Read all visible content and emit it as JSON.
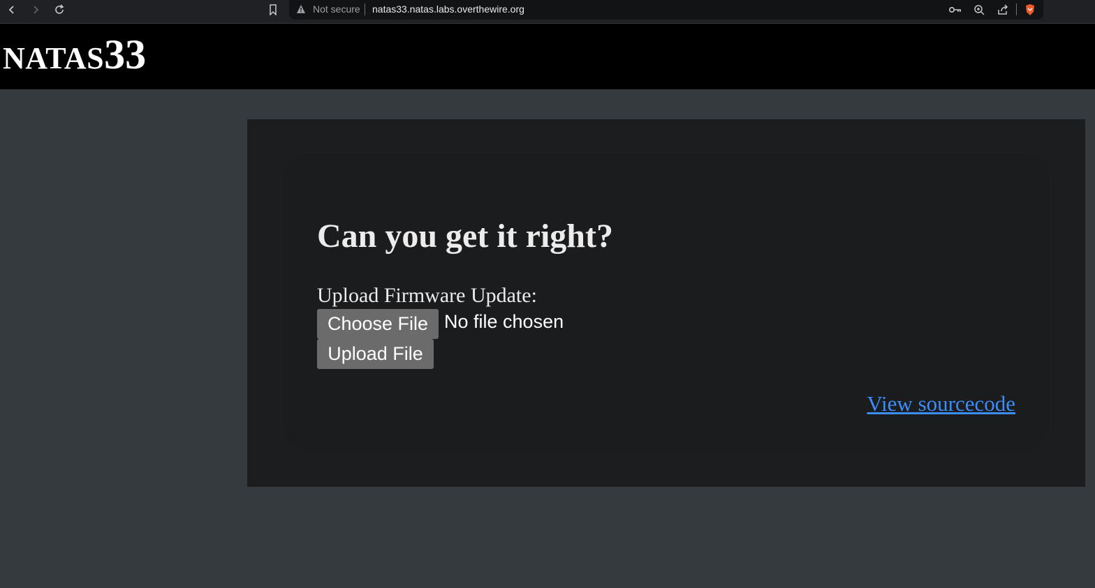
{
  "browser": {
    "security_label": "Not secure",
    "url": "natas33.natas.labs.overthewire.org",
    "icons": [
      "back-icon",
      "forward-icon",
      "reload-icon",
      "bookmark-icon",
      "warning-icon",
      "key-icon",
      "zoom-icon",
      "share-icon",
      "brave-shield-icon"
    ]
  },
  "header": {
    "title_prefix": "NATAS",
    "title_number": "33"
  },
  "content": {
    "heading": "Can you get it right?",
    "upload_label": "Upload Firmware Update:",
    "choose_file_label": "Choose File",
    "file_status": "No file chosen",
    "upload_button_label": "Upload File",
    "source_link": "View sourcecode"
  },
  "colors": {
    "page_bg": "#353a3e",
    "panel_bg": "#1c1d1f",
    "header_bg": "#000000",
    "link": "#3b8dfa",
    "button_bg": "#6b6b6b"
  }
}
